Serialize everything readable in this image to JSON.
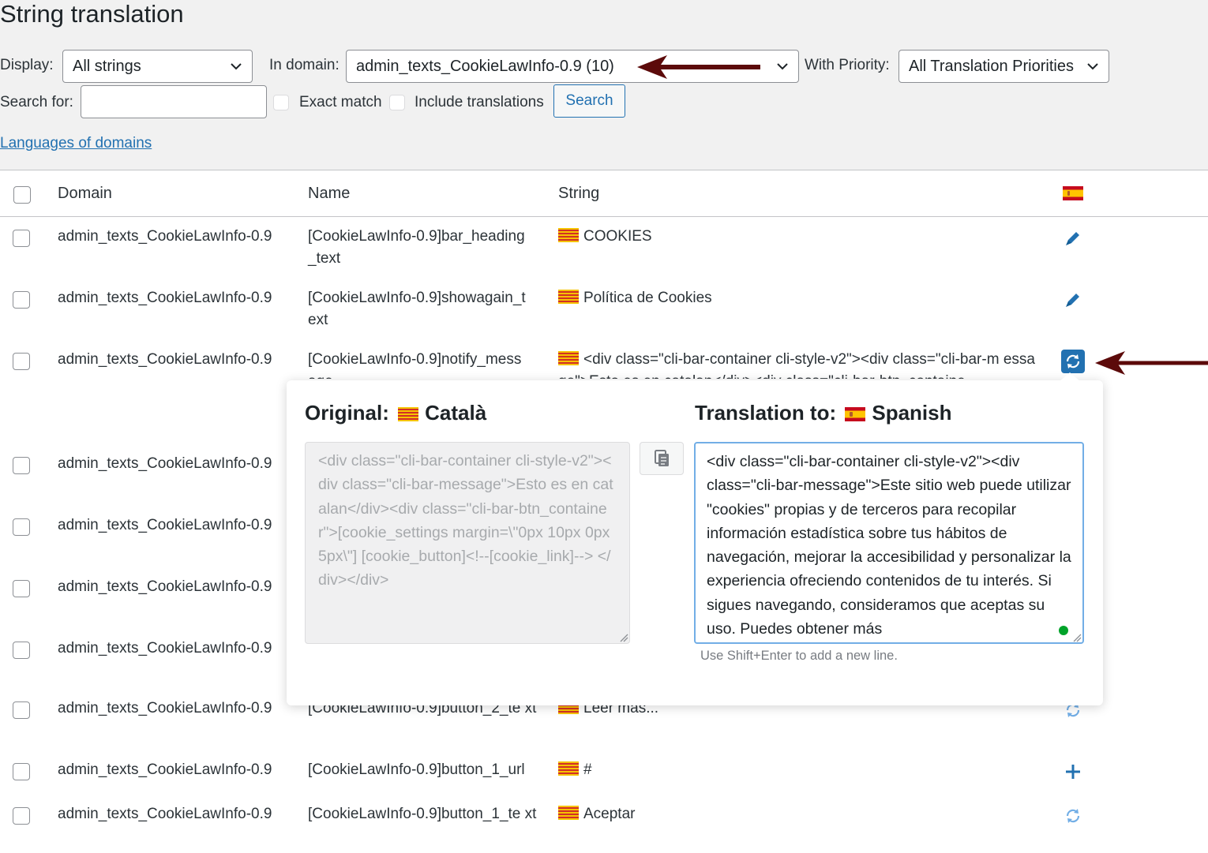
{
  "page_title": "String translation",
  "filters": {
    "display_label": "Display:",
    "display_value": "All strings",
    "domain_label": "In domain:",
    "domain_value": "admin_texts_CookieLawInfo-0.9 (10)",
    "priority_label": "With Priority:",
    "priority_value": "All Translation Priorities",
    "search_label": "Search for:",
    "search_value": "",
    "exact_match_label": "Exact match",
    "include_translations_label": "Include translations",
    "search_button": "Search",
    "languages_link": "Languages of domains"
  },
  "table": {
    "headers": {
      "domain": "Domain",
      "name": "Name",
      "string": "String"
    },
    "rows": [
      {
        "domain": "admin_texts_CookieLawInfo-0.9",
        "name": "[CookieLawInfo-0.9]bar_heading _text",
        "string": "COOKIES",
        "action": "pencil-icon"
      },
      {
        "domain": "admin_texts_CookieLawInfo-0.9",
        "name": "[CookieLawInfo-0.9]showagain_t ext",
        "string": "Política de Cookies",
        "action": "pencil-icon"
      },
      {
        "domain": "admin_texts_CookieLawInfo-0.9",
        "name": "[CookieLawInfo-0.9]notify_mess age",
        "string": "<div class=\"cli-bar-container cli-style-v2\"><div class=\"cli-bar-m essage\">Esto es en catalan</div><div class=\"cli-bar-btn_containe",
        "action": "translate-refresh-icon"
      },
      {
        "domain": "admin_texts_CookieLawInfo-0.9",
        "name": "",
        "string": "",
        "action": ""
      },
      {
        "domain": "admin_texts_CookieLawInfo-0.9",
        "name": "",
        "string": "",
        "action": ""
      },
      {
        "domain": "admin_texts_CookieLawInfo-0.9",
        "name": "",
        "string": "",
        "action": ""
      },
      {
        "domain": "admin_texts_CookieLawInfo-0.9",
        "name": "",
        "string": "",
        "action": ""
      },
      {
        "domain": "admin_texts_CookieLawInfo-0.9",
        "name": "[CookieLawInfo-0.9]button_2_te xt",
        "string": "Leer mas...",
        "action": "translate-refresh-icon"
      },
      {
        "domain": "admin_texts_CookieLawInfo-0.9",
        "name": "[CookieLawInfo-0.9]button_1_url",
        "string": "#",
        "action": "plus-icon"
      },
      {
        "domain": "admin_texts_CookieLawInfo-0.9",
        "name": "[CookieLawInfo-0.9]button_1_te xt",
        "string": "Aceptar",
        "action": "translate-refresh-icon"
      }
    ]
  },
  "popup": {
    "original_label": "Original:",
    "original_language": "Català",
    "translation_label": "Translation to:",
    "translation_language": "Spanish",
    "original_text": "<div class=\"cli-bar-container cli-style-v2\"><div class=\"cli-bar-message\">Esto es en catalan</div><div class=\"cli-bar-btn_container\">[cookie_settings margin=\\\"0px 10px 0px 5px\\\"] [cookie_button]<!--[cookie_link]--> </div></div>",
    "translation_text": "<div class=\"cli-bar-container cli-style-v2\"><div class=\"cli-bar-message\">Este sitio web puede utilizar \"cookies\" propias y de terceros para recopilar información estadística sobre tus hábitos de navegación, mejorar la accesibilidad y personalizar la experiencia ofreciendo contenidos de tu interés. Si sigues navegando, consideramos que aceptas su uso. Puedes obtener más",
    "hint": "Use Shift+Enter to add a new line."
  },
  "colors": {
    "accent": "#2271b1",
    "arrow": "#5c0a0a",
    "status_dot": "#00a32a"
  }
}
